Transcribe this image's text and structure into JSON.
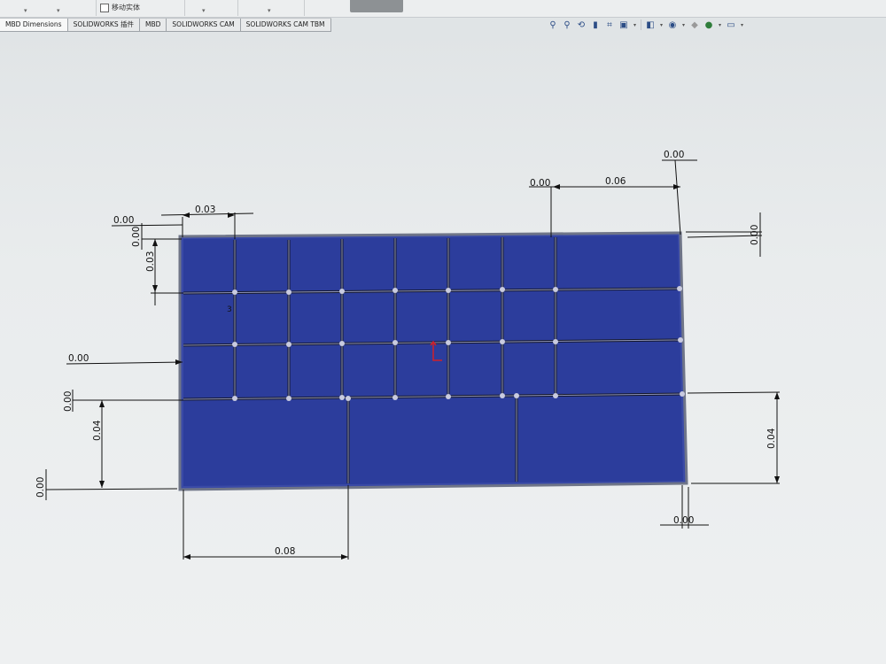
{
  "ribbon": {
    "move_solid_label": "移动实体"
  },
  "tabs": [
    {
      "label": "MBD Dimensions"
    },
    {
      "label": "SOLIDWORKS 插件"
    },
    {
      "label": "MBD"
    },
    {
      "label": "SOLIDWORKS CAM"
    },
    {
      "label": "SOLIDWORKS CAM TBM"
    }
  ],
  "view_toolbar": {
    "icons": [
      "zoom-to-fit-icon",
      "zoom-to-area-icon",
      "previous-view-icon",
      "section-view-icon",
      "dynamic-annotation-icon",
      "view-orientation-icon",
      "display-style-icon",
      "hide-show-items-icon",
      "edit-appearance-icon",
      "apply-scene-icon",
      "view-settings-icon"
    ]
  },
  "sketch": {
    "fill_color": "#2c3d9c",
    "border_color": "#6f7588",
    "line_color": "#111111",
    "origin_color": "#d0202a"
  },
  "dimensions": {
    "top_gap_small": "0.00",
    "top_width": "0.03",
    "left_vertical_gap": "0.00",
    "left_height": "0.03",
    "row3_left_gap": "0.00",
    "lower_left_gap": "0.00",
    "lower_left_height": "0.04",
    "bottom_left_gap": "0.00",
    "bottom_width": "0.08",
    "right_top_gap": "0.00",
    "right_top_small": "0.00",
    "right_top_width": "0.06",
    "right_side_small": "0.00",
    "right_height": "0.04",
    "bottom_right_small": "0.00",
    "cell_marker_label": "3"
  }
}
